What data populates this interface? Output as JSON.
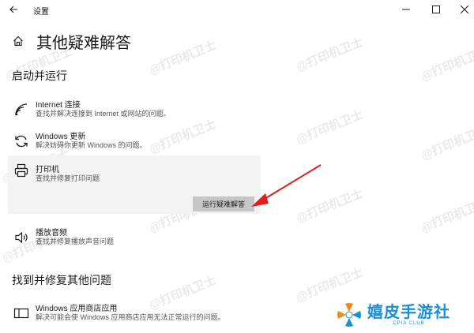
{
  "window": {
    "title": "设置",
    "controls": {
      "minimize": "—",
      "maximize": "☐",
      "close": "✕"
    }
  },
  "page": {
    "title": "其他疑难解答"
  },
  "sections": [
    {
      "title": "启动并运行"
    },
    {
      "title": "找到并修复其他问题"
    }
  ],
  "items": [
    {
      "name": "Internet 连接",
      "desc": "查找并解决连接到 Internet 或网站的问题。",
      "icon": "wifi-icon"
    },
    {
      "name": "Windows 更新",
      "desc": "解决妨碍你更新 Windows 的问题。",
      "icon": "refresh-icon"
    },
    {
      "name": "打印机",
      "desc": "查找并修复打印问题",
      "icon": "printer-icon",
      "button": "运行疑难解答"
    },
    {
      "name": "播放音频",
      "desc": "查找并修复播放声音问题",
      "icon": "speaker-icon"
    },
    {
      "name": "Windows 应用商店应用",
      "desc": "解决可能会使 Windows 应用商店应用无法正常运行的问题。",
      "icon": "app-window-icon"
    }
  ],
  "watermark": {
    "text": "@打印机卫士"
  },
  "logo": {
    "brand": "嬉皮手游社",
    "sub": "CPIA CLUB"
  },
  "colors": {
    "accent_arrow": "#e02020",
    "logo_blue": "#1a8fd6",
    "expanded_bg": "#f3f3f3",
    "button_bg": "#c6c6c6"
  }
}
